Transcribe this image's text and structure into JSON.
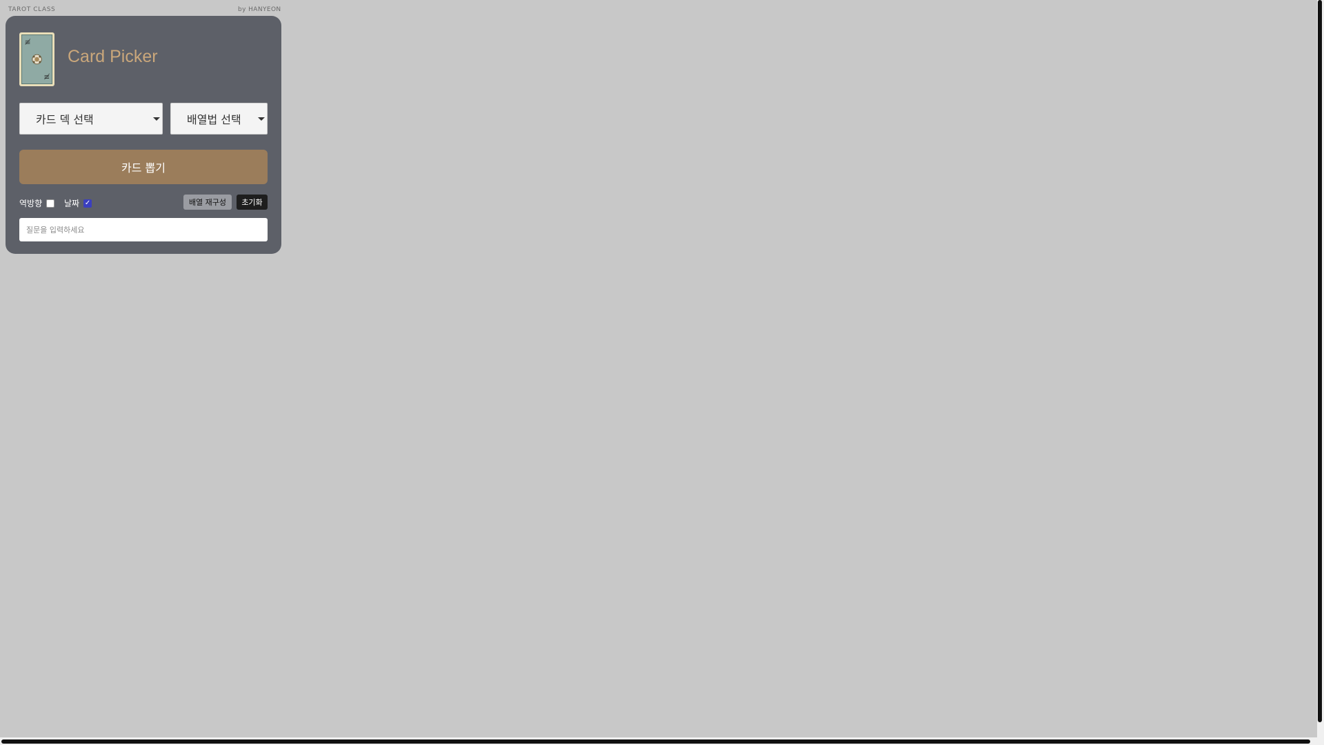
{
  "header": {
    "left": "TAROT CLASS",
    "right": "by HANYEON"
  },
  "panel": {
    "title": "Card Picker",
    "card_icon": "tarot-card-ace-of-pentacles-icon",
    "deck_select": {
      "selected": "카드 덱 선택"
    },
    "spread_select": {
      "selected": "배열법 선택"
    },
    "draw_button": "카드 뽑기",
    "options": {
      "reverse_label": "역방향",
      "reverse_checked": false,
      "date_label": "날짜",
      "date_checked": true
    },
    "rebuild_button": "배열 재구성",
    "reset_button": "초기화",
    "question": {
      "placeholder": "질문을 입력하세요",
      "value": ""
    }
  },
  "colors": {
    "background": "#c8c8c8",
    "panel": "#5d6068",
    "title": "#caa77b",
    "draw_button": "#9b7d5b",
    "checkbox_checked": "#3b3fbf"
  }
}
